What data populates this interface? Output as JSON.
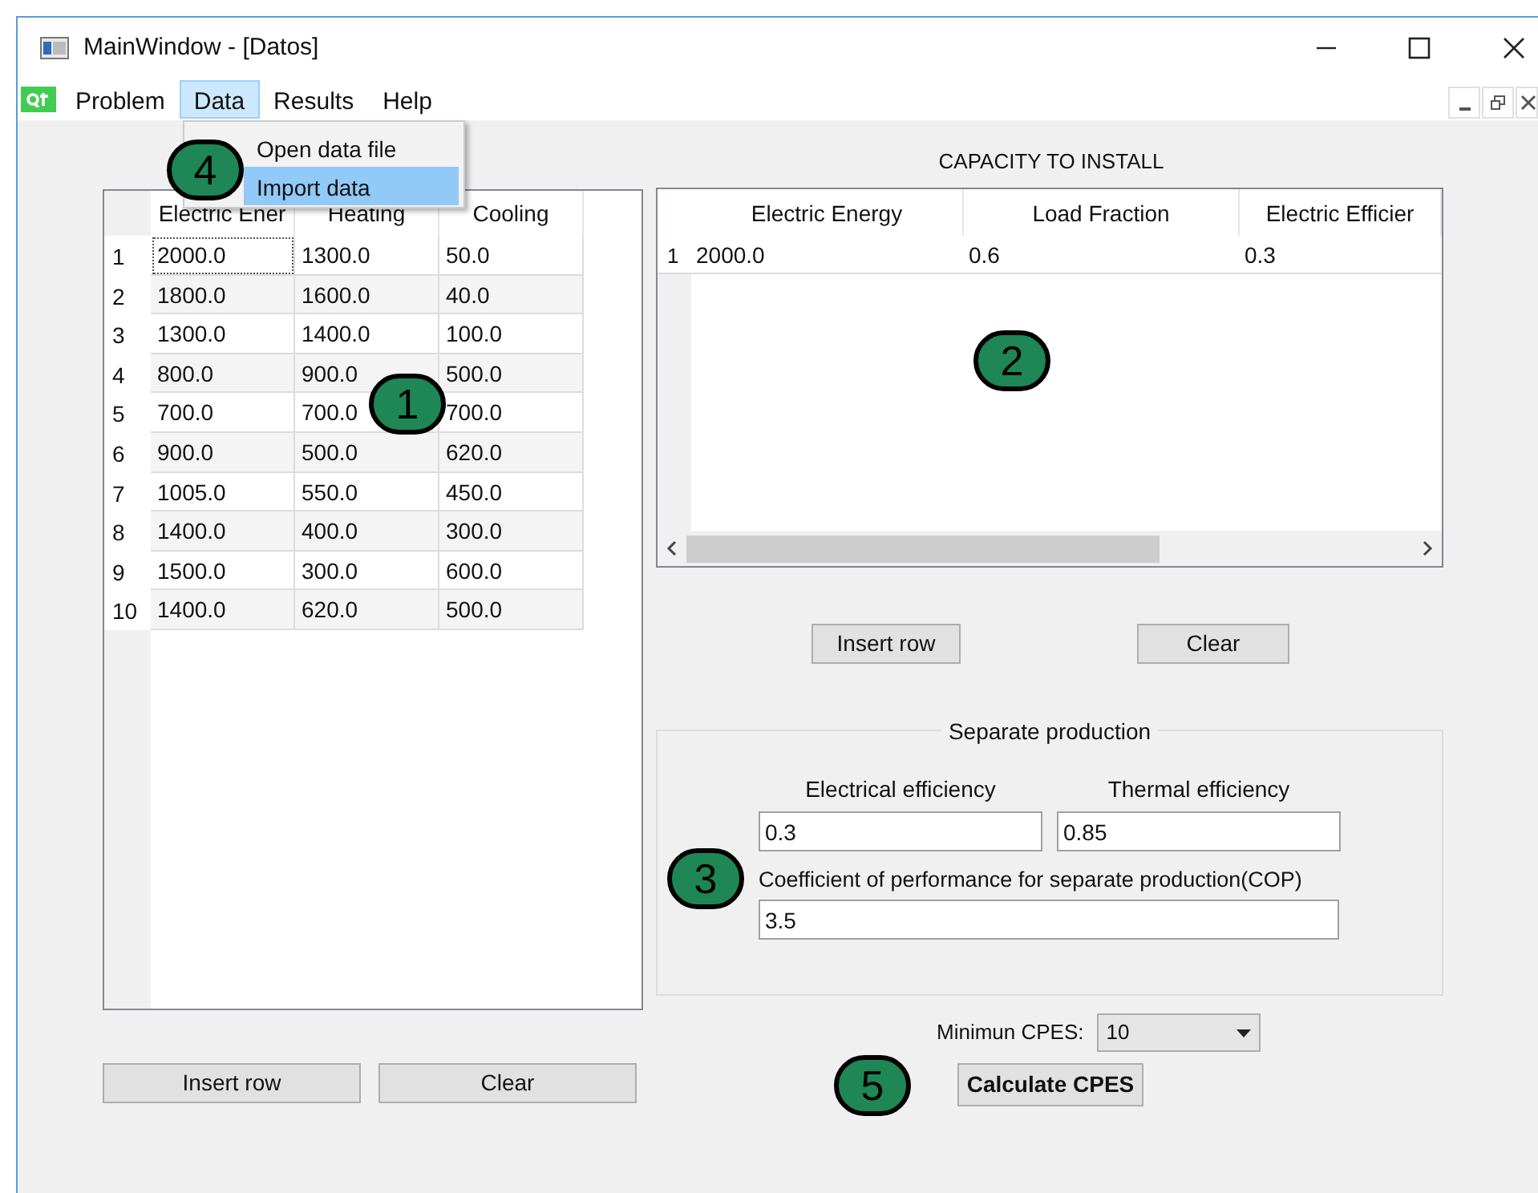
{
  "window": {
    "title": "MainWindow - [Datos]"
  },
  "menu": [
    {
      "label": "Problem",
      "selected": false
    },
    {
      "label": "Data",
      "selected": true
    },
    {
      "label": "Results",
      "selected": false
    },
    {
      "label": "Help",
      "selected": false
    }
  ],
  "dropdown": [
    {
      "label": "Open data file",
      "selected": false
    },
    {
      "label": "Import data",
      "selected": true
    }
  ],
  "demand_table": {
    "columns": [
      "Electric Ener",
      "Heating",
      "Cooling"
    ],
    "rows": [
      {
        "index": "1",
        "cells": [
          "2000.0",
          "1300.0",
          "50.0"
        ]
      },
      {
        "index": "2",
        "cells": [
          "1800.0",
          "1600.0",
          "40.0"
        ]
      },
      {
        "index": "3",
        "cells": [
          "1300.0",
          "1400.0",
          "100.0"
        ]
      },
      {
        "index": "4",
        "cells": [
          "800.0",
          "900.0",
          "500.0"
        ]
      },
      {
        "index": "5",
        "cells": [
          "700.0",
          "700.0",
          "700.0"
        ]
      },
      {
        "index": "6",
        "cells": [
          "900.0",
          "500.0",
          "620.0"
        ]
      },
      {
        "index": "7",
        "cells": [
          "1005.0",
          "550.0",
          "450.0"
        ]
      },
      {
        "index": "8",
        "cells": [
          "1400.0",
          "400.0",
          "300.0"
        ]
      },
      {
        "index": "9",
        "cells": [
          "1500.0",
          "300.0",
          "600.0"
        ]
      },
      {
        "index": "10",
        "cells": [
          "1400.0",
          "620.0",
          "500.0"
        ]
      }
    ],
    "buttons": [
      "Insert row",
      "Clear"
    ]
  },
  "capacity": {
    "title": "CAPACITY TO INSTALL",
    "columns": [
      "Electric Energy",
      "Load Fraction",
      "Electric Efficier"
    ],
    "rows": [
      {
        "index": "1",
        "cells": [
          "2000.0",
          "0.6",
          "0.3"
        ]
      }
    ],
    "buttons": [
      "Insert row",
      "Clear"
    ]
  },
  "separate_production": {
    "title": "Separate production",
    "fields": [
      {
        "label": "Electrical efficiency",
        "value": "0.3"
      },
      {
        "label": "Thermal efficiency",
        "value": "0.85"
      },
      {
        "label": "Coefficient of performance for separate production(COP)",
        "value": "3.5"
      }
    ]
  },
  "minimum_cpes": {
    "label": "Minimun CPES:",
    "value": "10"
  },
  "calculate_button": "Calculate CPES",
  "markers": [
    "1",
    "2",
    "3",
    "4",
    "5"
  ]
}
